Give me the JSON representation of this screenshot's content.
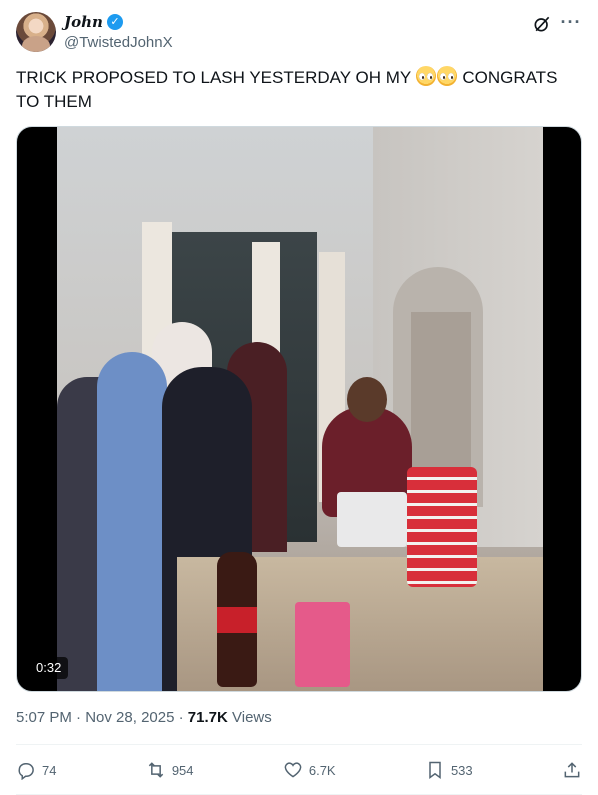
{
  "author": {
    "display_name": "John",
    "handle": "@TwistedJohnX",
    "verified": true
  },
  "tweet": {
    "text_before": "TRICK PROPOSED TO LASH YESTERDAY OH MY ",
    "emojis": [
      "pleading-face",
      "pleading-face"
    ],
    "text_after": " CONGRATS TO THEM"
  },
  "media": {
    "type": "video",
    "duration": "0:32"
  },
  "meta": {
    "time": "5:07 PM",
    "separator": "·",
    "date": "Nov 28, 2025",
    "views_count": "71.7K",
    "views_label": "Views"
  },
  "actions": {
    "replies": "74",
    "reposts": "954",
    "likes": "6.7K",
    "bookmarks": "533"
  },
  "icons": [
    "verified-badge-icon",
    "grok-icon",
    "more-icon",
    "reply-icon",
    "repost-icon",
    "like-icon",
    "bookmark-icon",
    "share-icon"
  ],
  "colors": {
    "text": "#0f1419",
    "secondary": "#536471",
    "accent": "#1d9bf0",
    "border": "#eff3f4"
  }
}
